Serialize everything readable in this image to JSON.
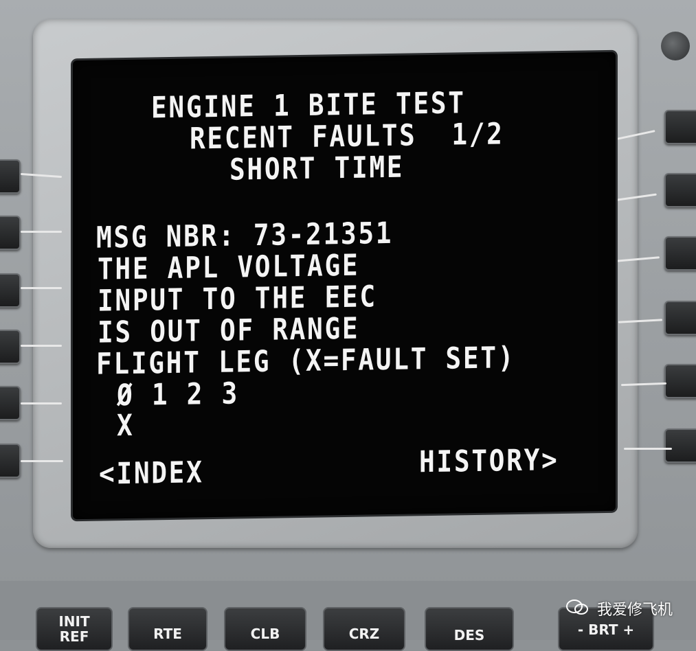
{
  "screen": {
    "title_lines": [
      "ENGINE 1 BITE TEST",
      "RECENT FAULTS  1/2",
      "SHORT TIME"
    ],
    "message": {
      "msg_nbr": "MSG NBR: 73-21351",
      "lines": [
        "THE APL VOLTAGE",
        "INPUT TO THE EEC",
        "IS OUT OF RANGE",
        "FLIGHT LEG (X=FAULT SET)",
        "Ø 1 2 3",
        "X"
      ]
    },
    "left_link": "<INDEX",
    "right_link": "HISTORY>"
  },
  "function_keys": {
    "init_ref": "INIT",
    "init_ref_2": "REF",
    "rte": "RTE",
    "clb": "CLB",
    "crz": "CRZ",
    "des": "DES",
    "brt": "- BRT +"
  },
  "watermark": "我爱修飞机",
  "colors": {
    "screen_bg": "#050505",
    "screen_text": "#f4f4f4",
    "bezel": "#b3b6b8"
  }
}
